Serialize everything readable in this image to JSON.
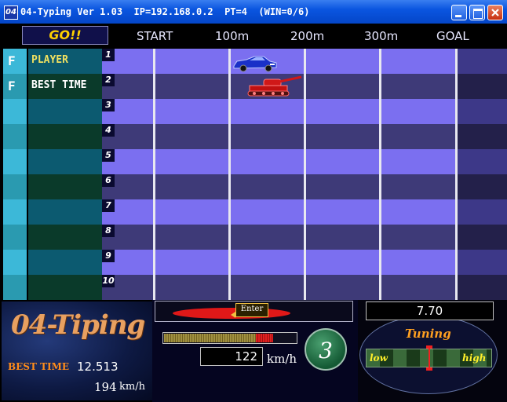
{
  "window": {
    "icon_text": "04",
    "title": "04-Typing Ver 1.03  IP=192.168.0.2  PT=4  (WIN=0/6)"
  },
  "header": {
    "go_label": "GO!!",
    "markers": [
      "START",
      "100m",
      "200m",
      "300m",
      "GOAL"
    ]
  },
  "lanes": [
    {
      "num": "1",
      "flag": "F",
      "name": "PLAYER",
      "name_color": "#f0e060"
    },
    {
      "num": "2",
      "flag": "F",
      "name": "BEST TIME",
      "name_color": "#ffffff"
    },
    {
      "num": "3",
      "flag": "",
      "name": "",
      "name_color": "#ffffff"
    },
    {
      "num": "4",
      "flag": "",
      "name": "",
      "name_color": "#ffffff"
    },
    {
      "num": "5",
      "flag": "",
      "name": "",
      "name_color": "#ffffff"
    },
    {
      "num": "6",
      "flag": "",
      "name": "",
      "name_color": "#ffffff"
    },
    {
      "num": "7",
      "flag": "",
      "name": "",
      "name_color": "#ffffff"
    },
    {
      "num": "8",
      "flag": "",
      "name": "",
      "name_color": "#ffffff"
    },
    {
      "num": "9",
      "flag": "",
      "name": "",
      "name_color": "#ffffff"
    },
    {
      "num": "10",
      "flag": "",
      "name": "",
      "name_color": "#ffffff"
    }
  ],
  "racers": [
    {
      "lane": 1,
      "type": "car-icon",
      "color": "#2030c0"
    },
    {
      "lane": 2,
      "type": "tank-icon",
      "color": "#d01818"
    }
  ],
  "best": {
    "logo": "04-Tiping",
    "label": "BEST TIME",
    "time": "12.513",
    "speed": "194",
    "speed_unit": "km/h"
  },
  "input": {
    "key_label": "Enter"
  },
  "speed": {
    "gauge_fraction": 0.83,
    "gauge_red_fraction": 0.13,
    "value": "122",
    "unit": "km/h"
  },
  "position": "3",
  "timer": "7.70",
  "tuning": {
    "label": "Tuning",
    "low": "low",
    "high": "high",
    "level": 0.5
  },
  "colors": {
    "accent_orange": "#ff8c1a",
    "lane_light": "#7b6ff0",
    "lane_dark": "#3e3a78"
  }
}
